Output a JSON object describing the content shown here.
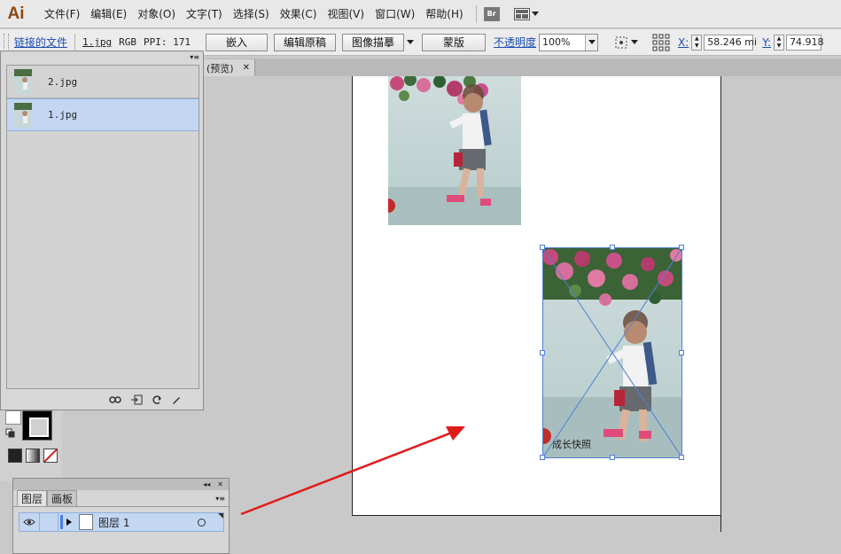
{
  "app": {
    "logo": "Ai"
  },
  "menubar": {
    "items": [
      "文件(F)",
      "编辑(E)",
      "对象(O)",
      "文字(T)",
      "选择(S)",
      "效果(C)",
      "视图(V)",
      "窗口(W)",
      "帮助(H)"
    ],
    "bridge_label": "Br"
  },
  "control_bar": {
    "linked_file_label": "链接的文件",
    "file_name": "1.jpg",
    "color_mode": "RGB",
    "ppi": "PPI: 171",
    "embed_label": "嵌入",
    "edit_original_label": "编辑原稿",
    "image_trace_label": "图像描摹",
    "mask_label": "蒙版",
    "opacity_label": "不透明度",
    "opacity_value": "100%",
    "x_label": "X:",
    "x_value": "58.246 mi",
    "y_label": "Y:",
    "y_value": "74.918"
  },
  "document_tab": {
    "label": "(预览)",
    "close": "✕"
  },
  "links_panel": {
    "items": [
      {
        "name": "2.jpg",
        "selected": false
      },
      {
        "name": "1.jpg",
        "selected": true
      }
    ]
  },
  "canvas": {
    "caption": "成长快照"
  },
  "layers_panel": {
    "tabs": [
      "图层",
      "画板"
    ],
    "layer_name": "图层 1"
  },
  "colors": {
    "selection": "#4f7fd6",
    "highlight_row": "#c3d7f2",
    "arrow": "#e01b1b"
  }
}
